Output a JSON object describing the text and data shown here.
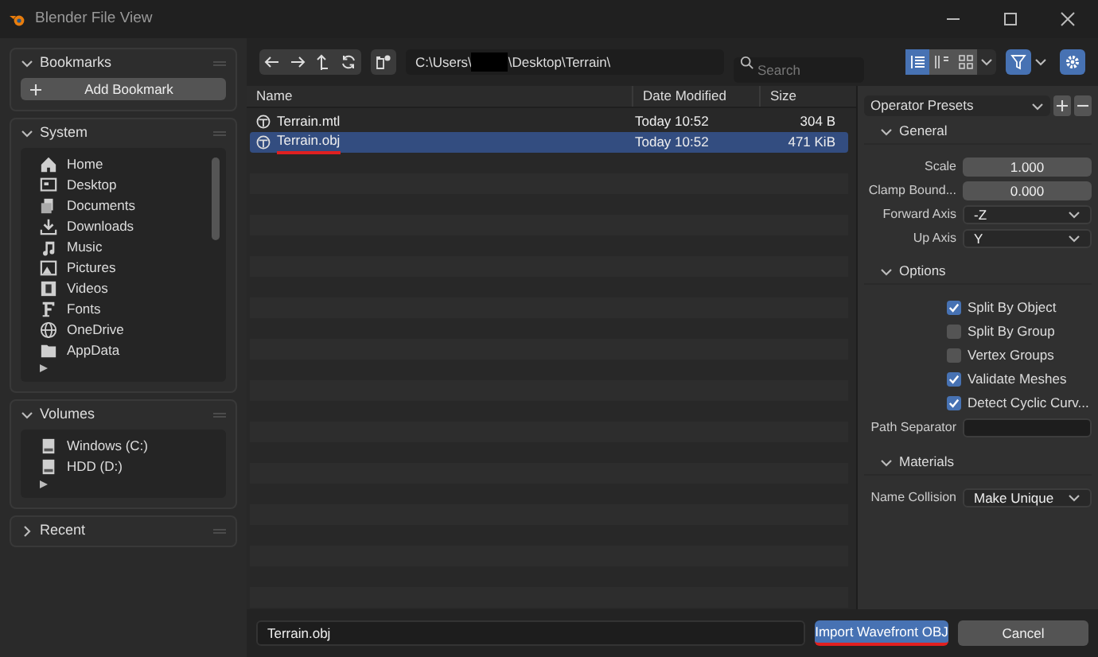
{
  "window": {
    "title": "Blender File View"
  },
  "sidebar": {
    "panels": [
      {
        "title": "Bookmarks",
        "expanded": true,
        "button": "Add Bookmark"
      },
      {
        "title": "System",
        "expanded": true,
        "items": [
          {
            "label": "Home",
            "kind": "home"
          },
          {
            "label": "Desktop",
            "kind": "desktop"
          },
          {
            "label": "Documents",
            "kind": "documents"
          },
          {
            "label": "Downloads",
            "kind": "downloads"
          },
          {
            "label": "Music",
            "kind": "music"
          },
          {
            "label": "Pictures",
            "kind": "pictures"
          },
          {
            "label": "Videos",
            "kind": "videos"
          },
          {
            "label": "Fonts",
            "kind": "fonts"
          },
          {
            "label": "OneDrive",
            "kind": "globe"
          },
          {
            "label": "AppData",
            "kind": "folder"
          }
        ]
      },
      {
        "title": "Volumes",
        "expanded": true,
        "items": [
          {
            "label": "Windows (C:)",
            "kind": "drive"
          },
          {
            "label": "HDD (D:)",
            "kind": "drive"
          }
        ]
      },
      {
        "title": "Recent",
        "expanded": false
      }
    ]
  },
  "toolbar": {
    "path_start": "C:\\Users\\",
    "path_end": "\\Desktop\\Terrain\\",
    "search": {
      "placeholder": "Search"
    },
    "views": [
      {
        "kind": "list",
        "selected": true
      },
      {
        "kind": "columns",
        "selected": false
      },
      {
        "kind": "grid",
        "selected": false
      }
    ],
    "filter_on": true
  },
  "table": {
    "columns": [
      "Name",
      "Date Modified",
      "Size"
    ],
    "rows": [
      {
        "name": "Terrain.mtl",
        "date": "Today 10:52",
        "size": "304 B",
        "selected": false,
        "underlined": false
      },
      {
        "name": "Terrain.obj",
        "date": "Today 10:52",
        "size": "471 KiB",
        "selected": true,
        "underlined": true
      }
    ]
  },
  "settings": {
    "presets": "Operator Presets",
    "sections": [
      {
        "title": "General",
        "rows": [
          {
            "kind": "number",
            "label": "Scale",
            "value": "1.000"
          },
          {
            "kind": "number",
            "label": "Clamp Bound...",
            "value": "0.000"
          },
          {
            "kind": "select",
            "label": "Forward Axis",
            "value": "-Z"
          },
          {
            "kind": "select",
            "label": "Up Axis",
            "value": "Y"
          }
        ]
      },
      {
        "title": "Options",
        "rows": [
          {
            "kind": "check",
            "label": "Split By Object",
            "checked": true
          },
          {
            "kind": "check",
            "label": "Split By Group",
            "checked": false
          },
          {
            "kind": "check",
            "label": "Vertex Groups",
            "checked": false
          },
          {
            "kind": "check",
            "label": "Validate Meshes",
            "checked": true
          },
          {
            "kind": "check",
            "label": "Detect Cyclic Curv...",
            "checked": true
          },
          {
            "kind": "text",
            "label": "Path Separator"
          }
        ]
      },
      {
        "title": "Materials",
        "rows": [
          {
            "kind": "select",
            "label": "Name Collision",
            "value": "Make Unique"
          }
        ]
      }
    ]
  },
  "footer": {
    "filename": "Terrain.obj",
    "confirm": "Import Wavefront OBJ",
    "cancel": "Cancel"
  }
}
